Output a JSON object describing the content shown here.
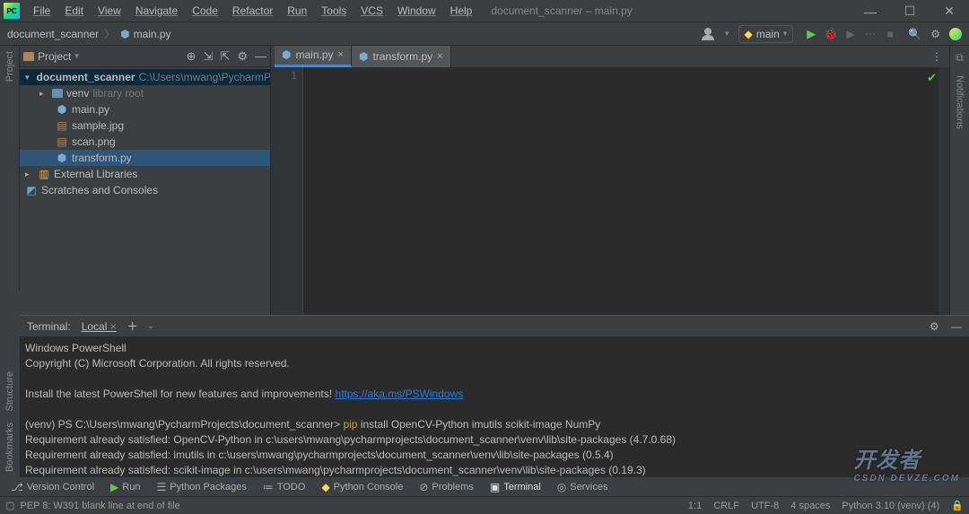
{
  "window": {
    "title": "document_scanner – main.py",
    "menu": [
      "File",
      "Edit",
      "View",
      "Navigate",
      "Code",
      "Refactor",
      "Run",
      "Tools",
      "VCS",
      "Window",
      "Help"
    ]
  },
  "breadcrumb": {
    "project": "document_scanner",
    "file": "main.py"
  },
  "runconfig": {
    "name": "main"
  },
  "project_panel": {
    "title": "Project",
    "root": "document_scanner",
    "root_path": "C:\\Users\\mwang\\PycharmProjects",
    "tree": {
      "venv": "venv",
      "venv_note": "library root",
      "main": "main.py",
      "sample": "sample.jpg",
      "scan": "scan.png",
      "transform": "transform.py",
      "extlib": "External Libraries",
      "scratch": "Scratches and Consoles"
    }
  },
  "editor": {
    "tabs": [
      {
        "name": "main.py",
        "active": true
      },
      {
        "name": "transform.py",
        "active": false
      }
    ],
    "gutter_line": "1"
  },
  "terminal": {
    "label": "Terminal:",
    "tab": "Local",
    "lines": {
      "l1": "Windows PowerShell",
      "l2": "Copyright (C) Microsoft Corporation. All rights reserved.",
      "l3": "Install the latest PowerShell for new features and improvements! ",
      "l3link": "https://aka.ms/PSWindows",
      "l4prompt": "(venv) PS C:\\Users\\mwang\\PycharmProjects\\document_scanner> ",
      "l4cmd": "pip",
      "l4rest": " install OpenCV-Python imutils scikit-image NumPy",
      "l5": "Requirement already satisfied: OpenCV-Python in c:\\users\\mwang\\pycharmprojects\\document_scanner\\venv\\lib\\site-packages (4.7.0.68)",
      "l6": "Requirement already satisfied: imutils in c:\\users\\mwang\\pycharmprojects\\document_scanner\\venv\\lib\\site-packages (0.5.4)",
      "l7": "Requirement already satisfied: scikit-image in c:\\users\\mwang\\pycharmprojects\\document_scanner\\venv\\lib\\site-packages (0.19.3)"
    }
  },
  "toolwindows": {
    "version_control": "Version Control",
    "run": "Run",
    "python_packages": "Python Packages",
    "todo": "TODO",
    "python_console": "Python Console",
    "problems": "Problems",
    "terminal": "Terminal",
    "services": "Services"
  },
  "statusbar": {
    "left": "PEP 8: W391 blank line at end of file",
    "pos": "1:1",
    "sep": "CRLF",
    "enc": "UTF-8",
    "indent": "4 spaces",
    "interp": "Python 3.10 (venv) (4)"
  },
  "sidetext": {
    "project": "Project",
    "bookmarks": "Bookmarks",
    "structure": "Structure",
    "notifications": "Notifications"
  },
  "watermark": {
    "cn": "开发者",
    "en": "CSDN DEVZE.COM"
  }
}
